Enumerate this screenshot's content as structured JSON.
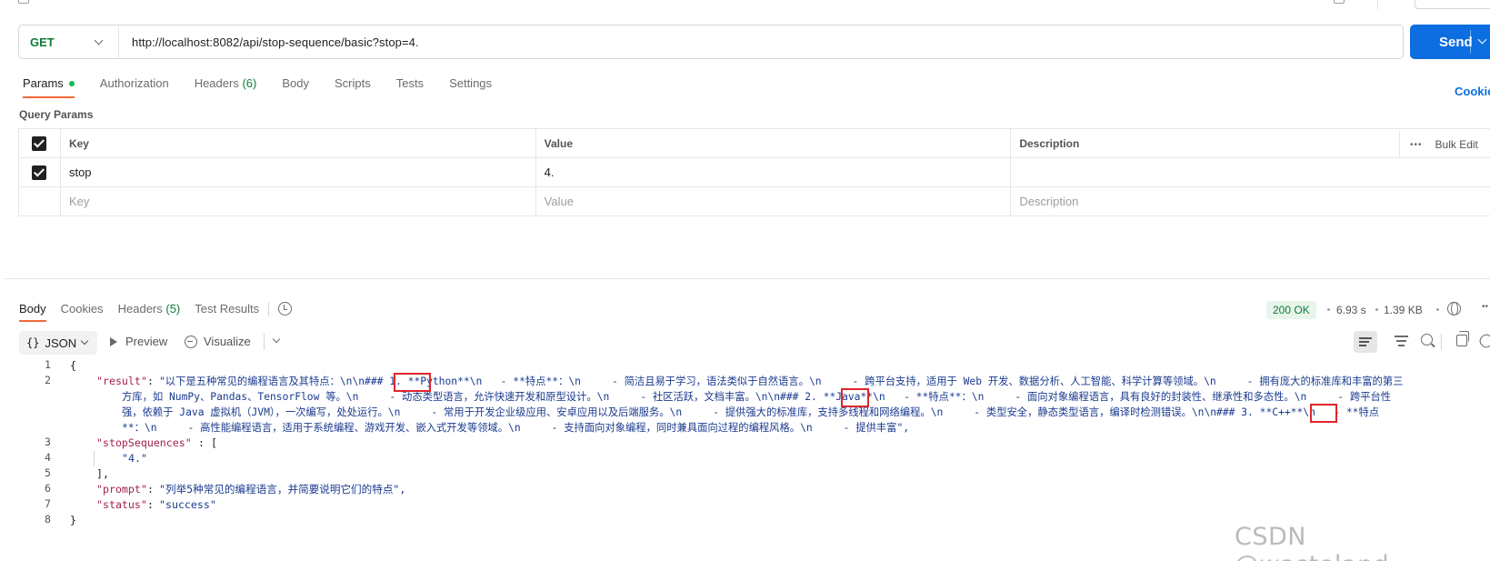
{
  "request": {
    "method": "GET",
    "url": "http://localhost:8082/api/stop-sequence/basic?stop=4.",
    "send_label": "Send"
  },
  "request_tabs": [
    {
      "label": "Params",
      "active": true
    },
    {
      "label": "Authorization"
    },
    {
      "label": "Headers",
      "count": "(6)"
    },
    {
      "label": "Body"
    },
    {
      "label": "Scripts"
    },
    {
      "label": "Tests"
    },
    {
      "label": "Settings"
    }
  ],
  "cookies_link": "Cookie",
  "query_params": {
    "title": "Query Params",
    "headers": {
      "key": "Key",
      "value": "Value",
      "description": "Description"
    },
    "bulk_edit": "Bulk Edit",
    "rows": [
      {
        "checked": true,
        "key": "stop",
        "value": "4.",
        "description": ""
      }
    ],
    "placeholder": {
      "key": "Key",
      "value": "Value",
      "description": "Description"
    }
  },
  "response_tabs": [
    {
      "label": "Body",
      "active": true
    },
    {
      "label": "Cookies"
    },
    {
      "label": "Headers",
      "count": "(5)"
    },
    {
      "label": "Test Results"
    }
  ],
  "response_meta": {
    "status": "200 OK",
    "time": "6.93 s",
    "size": "1.39 KB"
  },
  "response_toolbar": {
    "format": "JSON",
    "preview": "Preview",
    "visualize": "Visualize"
  },
  "code": {
    "line_numbers": [
      "1",
      "2",
      "3",
      "4",
      "5",
      "6",
      "7",
      "8"
    ],
    "open_brace": "{",
    "close_brace": "}",
    "result_key": "\"result\"",
    "result_lines": [
      "\"以下是五种常见的编程语言及其特点：\\n\\n### 1. **Python**\\n   - **特点**：\\n     - 简洁且易于学习，语法类似于自然语言。\\n     - 跨平台支持，适用于 Web 开发、数据分析、人工智能、科学计算等领域。\\n     - 拥有庞大的标准库和丰富的第三",
      "方库，如 NumPy、Pandas、TensorFlow 等。\\n     - 动态类型语言，允许快速开发和原型设计。\\n     - 社区活跃，文档丰富。\\n\\n### 2. **Java**\\n   - **特点**：\\n     - 面向对象编程语言，具有良好的封装性、继承性和多态性。\\n     - 跨平台性",
      "强，依赖于 Java 虚拟机（JVM），一次编写，处处运行。\\n     - 常用于开发企业级应用、安卓应用以及后端服务。\\n     - 提供强大的标准库，支持多线程和网络编程。\\n     - 类型安全，静态类型语言，编译时检测错误。\\n\\n### 3. **C++**\\n   - **特点",
      "**：\\n     - 高性能编程语言，适用于系统编程、游戏开发、嵌入式开发等领域。\\n     - 支持面向对象编程，同时兼具面向过程的编程风格。\\n     - 提供丰富\","
    ],
    "stop_key": "\"stopSequences\"",
    "stop_open": ": [",
    "stop_value": "\"4.\"",
    "stop_close": "],",
    "prompt_key": "\"prompt\"",
    "prompt_value": "\"列举5种常见的编程语言，并简要说明它们的特点\",",
    "status_key": "\"status\"",
    "status_value": "\"success\""
  },
  "watermark": "CSDN @wasteland~"
}
